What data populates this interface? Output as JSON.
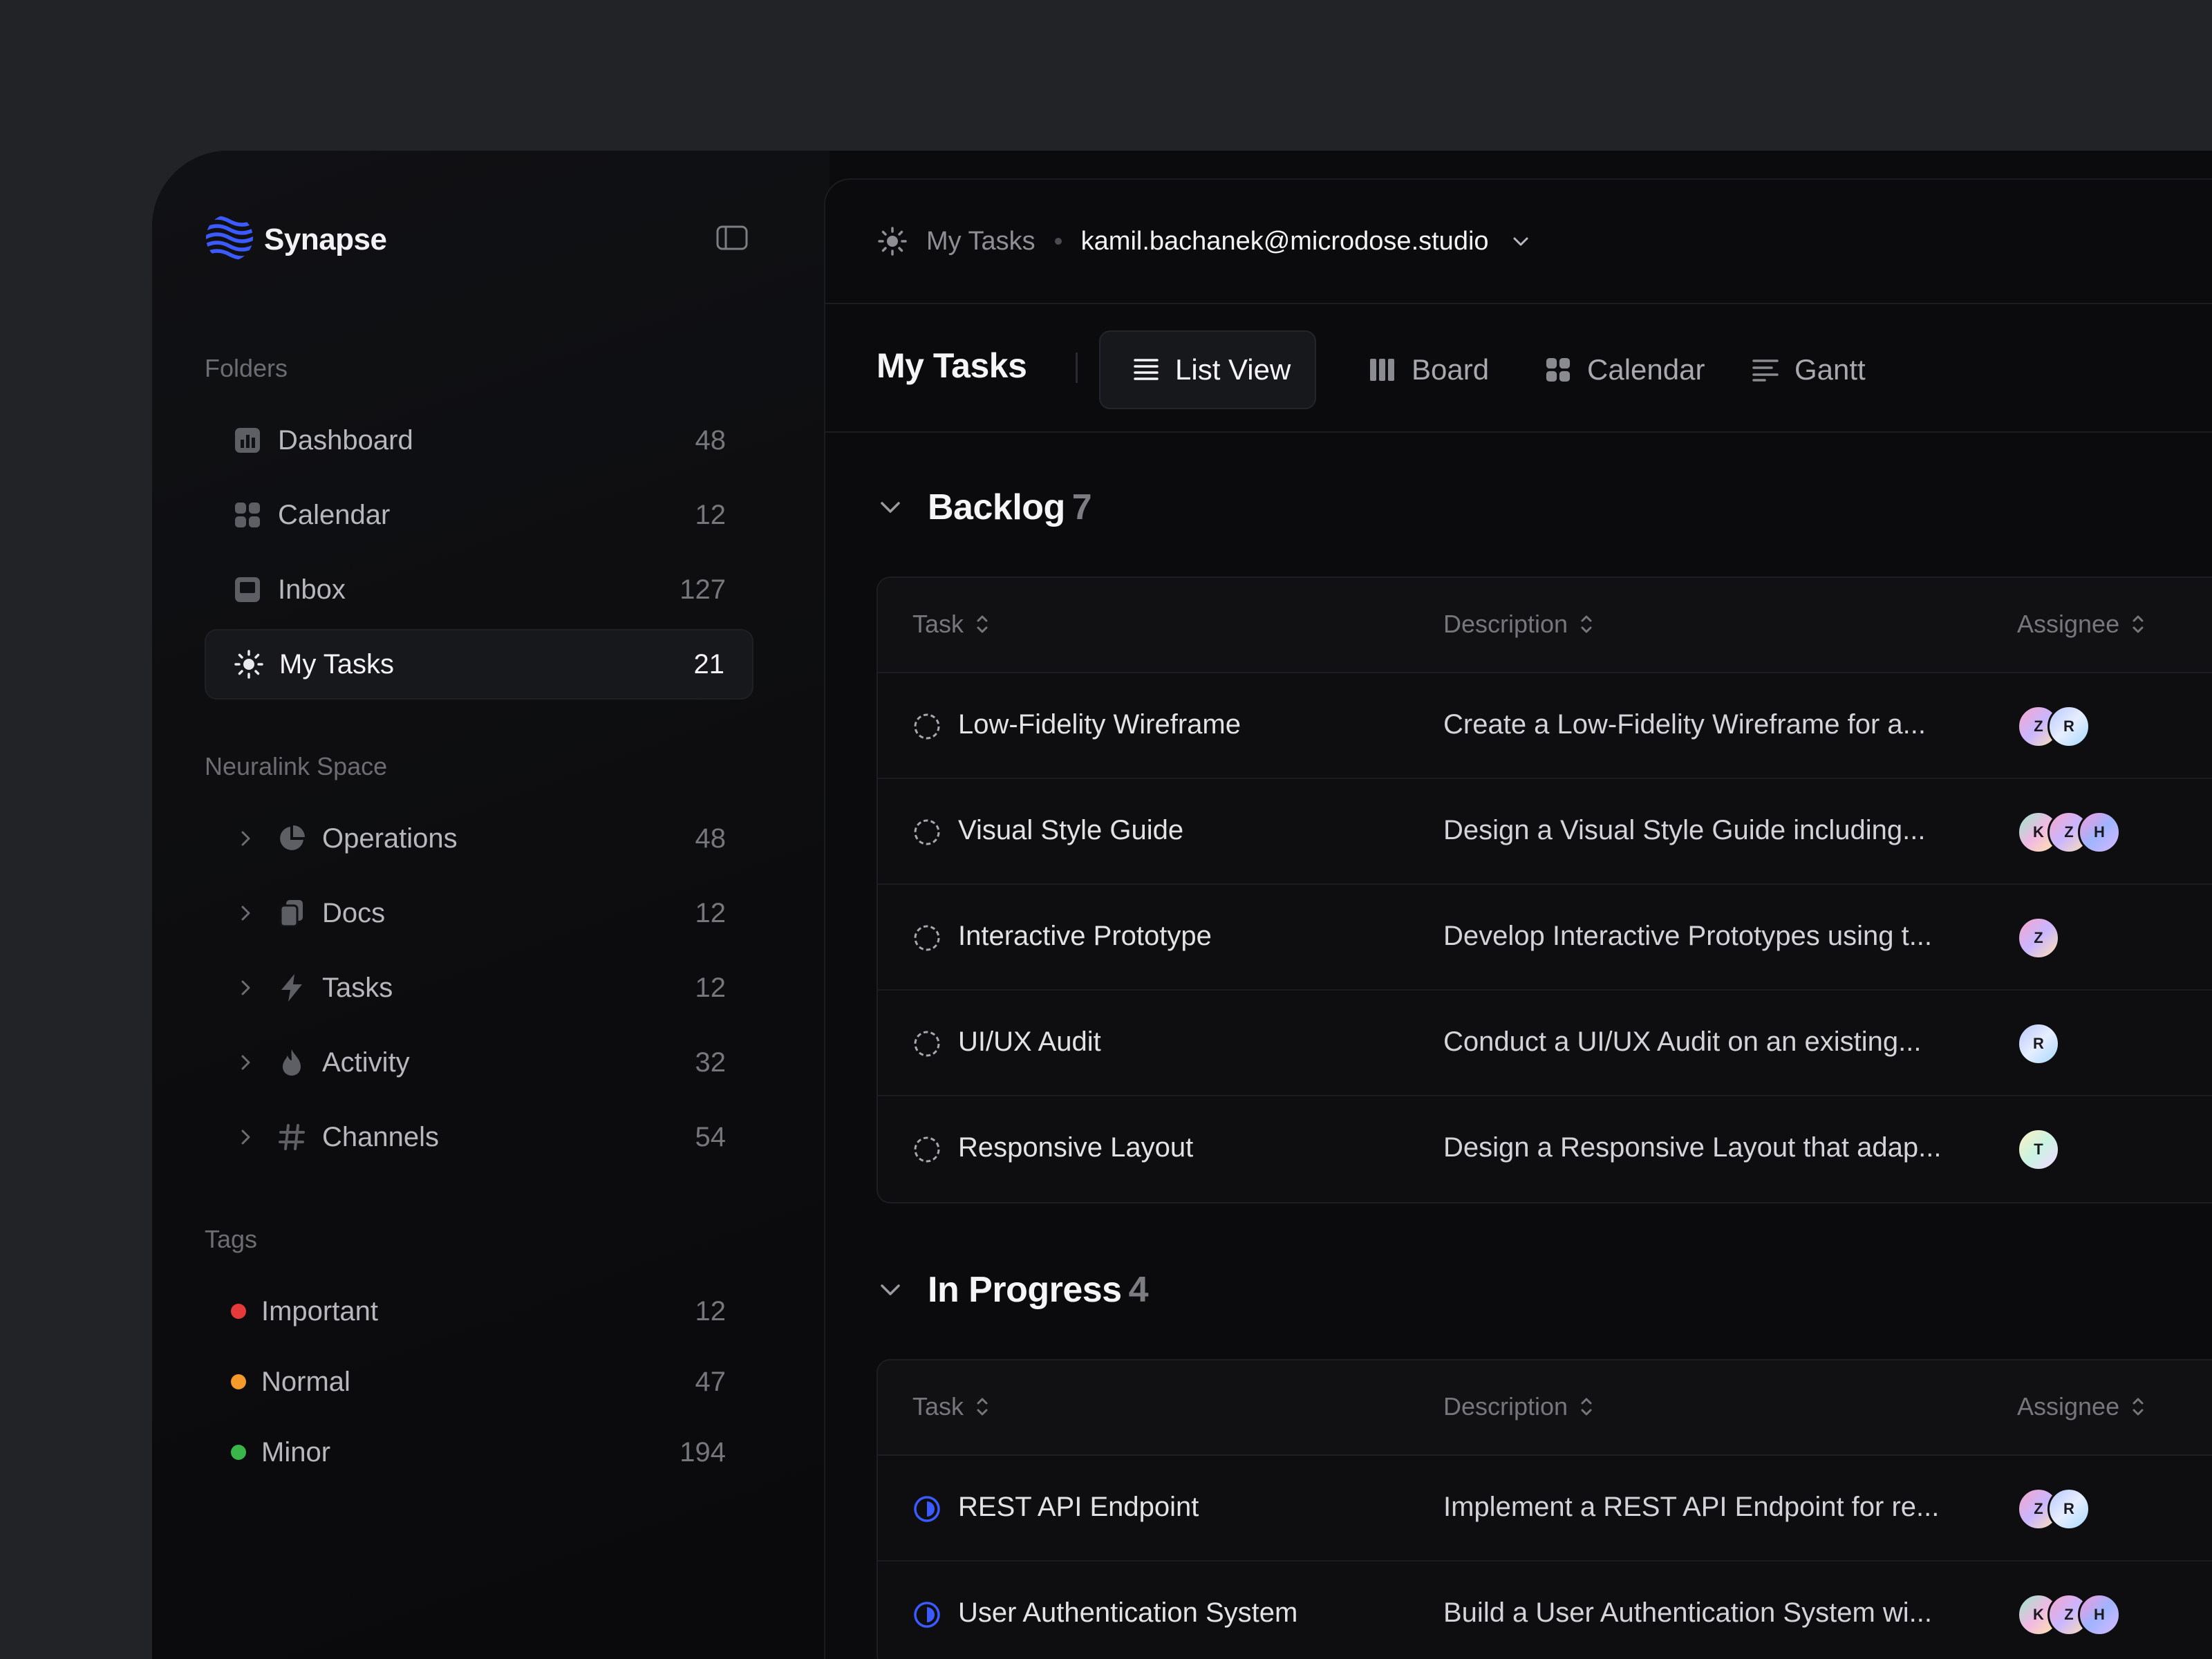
{
  "app": {
    "name": "Synapse"
  },
  "sidebar": {
    "folders_title": "Folders",
    "folders": [
      {
        "label": "Dashboard",
        "count": "48",
        "icon": "chart-icon"
      },
      {
        "label": "Calendar",
        "count": "12",
        "icon": "grid-icon"
      },
      {
        "label": "Inbox",
        "count": "127",
        "icon": "inbox-icon"
      },
      {
        "label": "My Tasks",
        "count": "21",
        "icon": "sun-icon",
        "active": true
      }
    ],
    "space_title": "Neuralink Space",
    "spaces": [
      {
        "label": "Operations",
        "count": "48",
        "icon": "pie-icon"
      },
      {
        "label": "Docs",
        "count": "12",
        "icon": "docs-icon"
      },
      {
        "label": "Tasks",
        "count": "12",
        "icon": "bolt-icon"
      },
      {
        "label": "Activity",
        "count": "32",
        "icon": "flame-icon"
      },
      {
        "label": "Channels",
        "count": "54",
        "icon": "hash-icon"
      }
    ],
    "tags_title": "Tags",
    "tags": [
      {
        "label": "Important",
        "count": "12",
        "color": "#e5393a"
      },
      {
        "label": "Normal",
        "count": "47",
        "color": "#f39a2b"
      },
      {
        "label": "Minor",
        "count": "194",
        "color": "#3ab54a"
      }
    ]
  },
  "topbar": {
    "crumb": "My Tasks",
    "email": "kamil.bachanek@microdose.studio"
  },
  "view": {
    "title": "My Tasks",
    "tabs": [
      {
        "label": "List View",
        "icon": "list-icon",
        "active": true
      },
      {
        "label": "Board",
        "icon": "board-icon"
      },
      {
        "label": "Calendar",
        "icon": "calendar-grid-icon"
      },
      {
        "label": "Gantt",
        "icon": "gantt-icon"
      }
    ]
  },
  "columns": {
    "task": "Task",
    "description": "Description",
    "assignee": "Assignee"
  },
  "groups": [
    {
      "title": "Backlog",
      "count": "7",
      "status": "todo",
      "rows": [
        {
          "task": "Low-Fidelity Wireframe",
          "description": "Create a Low-Fidelity Wireframe for a...",
          "assignees": [
            "Z",
            "R"
          ]
        },
        {
          "task": "Visual Style Guide",
          "description": "Design a Visual Style Guide including...",
          "assignees": [
            "K",
            "Z",
            "H"
          ]
        },
        {
          "task": "Interactive Prototype",
          "description": "Develop Interactive Prototypes using t...",
          "assignees": [
            "Z"
          ]
        },
        {
          "task": "UI/UX Audit",
          "description": "Conduct a UI/UX Audit on an existing...",
          "assignees": [
            "R"
          ]
        },
        {
          "task": "Responsive Layout",
          "description": "Design a Responsive Layout that adap...",
          "assignees": [
            "T"
          ]
        }
      ]
    },
    {
      "title": "In Progress",
      "count": "4",
      "status": "in-progress",
      "rows": [
        {
          "task": "REST API Endpoint",
          "description": "Implement a REST API Endpoint for re...",
          "assignees": [
            "Z",
            "R"
          ]
        },
        {
          "task": "User Authentication System",
          "description": "Build a User Authentication System wi...",
          "assignees": [
            "K",
            "Z",
            "H"
          ]
        }
      ]
    }
  ],
  "colors": {
    "accent": "#3b5bff",
    "background": "#0b0b0d",
    "page": "#222327"
  }
}
